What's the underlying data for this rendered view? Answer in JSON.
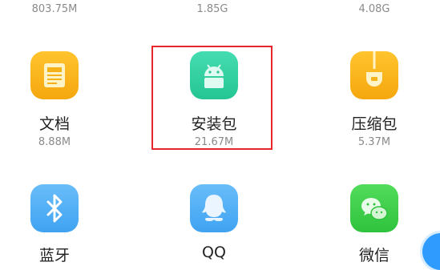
{
  "top_row": [
    {
      "size": "803.75M"
    },
    {
      "size": "1.85G"
    },
    {
      "size": "4.08G"
    }
  ],
  "row2": [
    {
      "label": "文档",
      "size": "8.88M",
      "icon": "document-icon",
      "color": "#f9b219"
    },
    {
      "label": "安装包",
      "size": "21.67M",
      "icon": "android-icon",
      "color": "#2fd0a0"
    },
    {
      "label": "压缩包",
      "size": "5.37M",
      "icon": "archive-icon",
      "color": "#f9b219"
    }
  ],
  "row3": [
    {
      "label": "蓝牙",
      "icon": "bluetooth-icon",
      "color": "#4fb0f7"
    },
    {
      "label": "QQ",
      "icon": "qq-icon",
      "color": "#4fb0f7"
    },
    {
      "label": "微信",
      "icon": "wechat-icon",
      "color": "#3ecf4a"
    }
  ],
  "highlight_color": "#e8262c",
  "fab_color": "#2f9bff"
}
